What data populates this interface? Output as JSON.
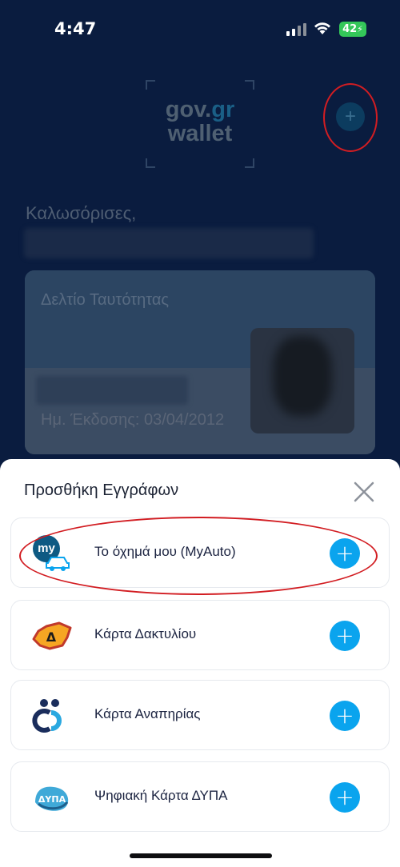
{
  "status_bar": {
    "time": "4:47",
    "battery": "42",
    "icons": [
      "signal-icon",
      "wifi-icon",
      "battery-charging-icon"
    ]
  },
  "header": {
    "logo_line1_gov": "gov.",
    "logo_line1_gr": "gr",
    "logo_line2": "wallet",
    "add_icon": "plus-icon"
  },
  "home": {
    "welcome": "Καλωσόρισες,",
    "id_card": {
      "title": "Δελτίο Ταυτότητας",
      "issue_date": "Ημ. Έκδοσης: 03/04/2012"
    }
  },
  "sheet": {
    "title": "Προσθήκη Εγγράφων",
    "close_icon": "close-icon",
    "items": [
      {
        "label": "Το όχημά μου (MyAuto)",
        "icon": "myauto-car-icon"
      },
      {
        "label": "Κάρτα Δακτυλίου",
        "icon": "delta-ring-icon"
      },
      {
        "label": "Κάρτα Αναπηρίας",
        "icon": "disability-card-icon"
      },
      {
        "label": "Ψηφιακή Κάρτα ΔΥΠΑ",
        "icon": "dypa-logo-icon"
      }
    ],
    "myauto_badge": "my",
    "dypa_badge": "ΔΥΠΑ",
    "delta_badge": "Δ"
  },
  "colors": {
    "accent_blue": "#0aa4ee",
    "annotation_red": "#d21d22",
    "background_navy": "#0a1c3f"
  }
}
